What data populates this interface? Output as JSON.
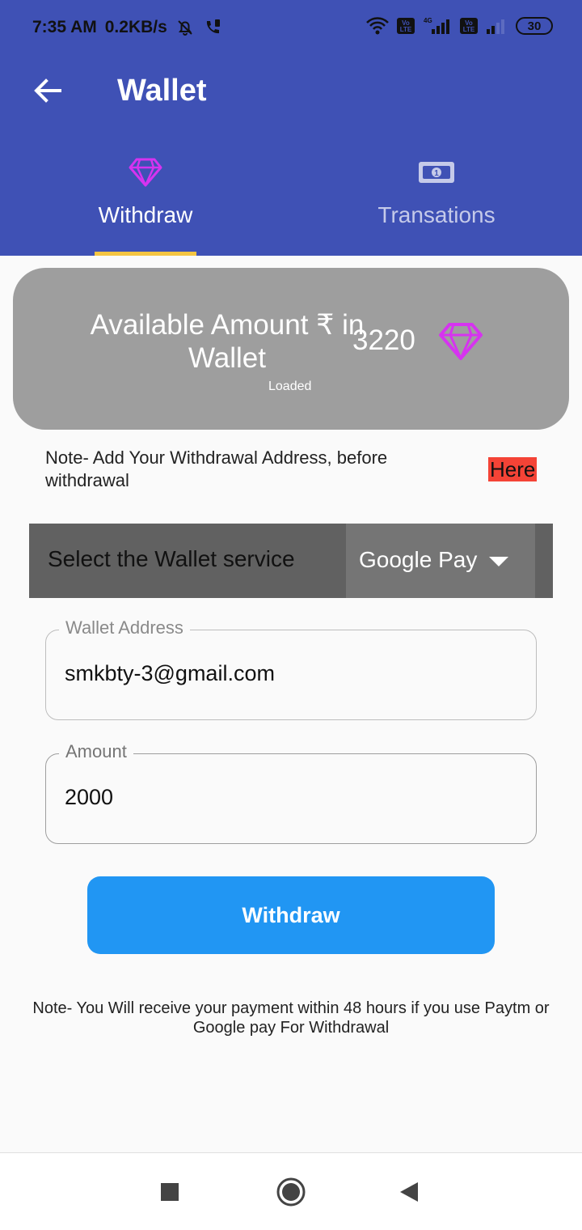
{
  "status_bar": {
    "time": "7:35 AM",
    "speed": "0.2KB/s",
    "network_label": "4G",
    "volte_label": "Vo LTE",
    "battery": "30"
  },
  "header": {
    "title": "Wallet"
  },
  "tabs": [
    {
      "label": "Withdraw",
      "icon": "diamond-icon",
      "active": true
    },
    {
      "label": "Transations",
      "icon": "banknote-icon",
      "active": false
    }
  ],
  "colors": {
    "appbar": "#3f51b5",
    "tab_indicator": "#f4c542",
    "accent_button": "#2196f3",
    "gem": "#d633f0",
    "here_highlight": "#f44336"
  },
  "wallet_card": {
    "label": "Available Amount ₹ in Wallet",
    "amount": "3220",
    "status": "Loaded",
    "icon": "diamond-icon"
  },
  "note": {
    "text": "Note- Add Your Withdrawal Address, before withdrawal",
    "link_label": "Here"
  },
  "wallet_service": {
    "label": "Select the Wallet service",
    "selected": "Google Pay"
  },
  "fields": {
    "wallet_address": {
      "label": "Wallet Address",
      "value": "smkbty-3@gmail.com"
    },
    "amount": {
      "label": "Amount",
      "value": "2000"
    }
  },
  "withdraw_button": {
    "label": "Withdraw"
  },
  "footer_note": "Note- You Will receive your payment within 48 hours if you use Paytm or Google pay For Withdrawal"
}
